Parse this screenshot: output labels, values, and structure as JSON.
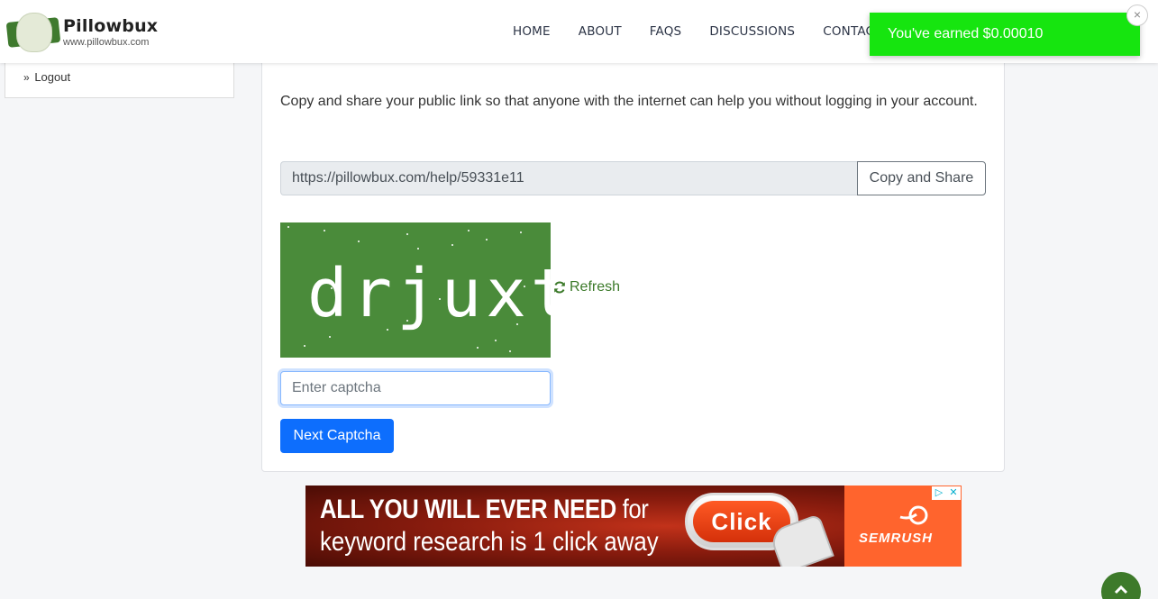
{
  "brand": {
    "name": "Pillowbux",
    "url": "www.pillowbux.com"
  },
  "nav": {
    "items": [
      "HOME",
      "ABOUT",
      "FAQS",
      "DISCUSSIONS",
      "CONTACT"
    ]
  },
  "toast": {
    "message": "You've earned $0.00010",
    "close": "×",
    "color": "#16e50f"
  },
  "sidebar": {
    "items": [
      {
        "label": "Logout",
        "icon": "double-chevron-right-icon"
      }
    ]
  },
  "main": {
    "description": "Copy and share your public link so that anyone with the internet can help you without logging in your account.",
    "public_link": "https://pillowbux.com/help/59331e11",
    "copy_button": "Copy and Share",
    "captcha": {
      "text": "drjuxt",
      "background": "#4a8b3a",
      "refresh_label": "Refresh",
      "input_placeholder": "Enter captcha",
      "input_value": "",
      "next_button": "Next Captcha"
    }
  },
  "ad": {
    "line1_bold": "ALL YOU WILL EVER NEED",
    "line1_rest": " for",
    "line2": "keyword research is 1 click away",
    "button": "Click",
    "brand": "SEMRUSH"
  },
  "colors": {
    "accent_green": "#3d7a2a",
    "primary_blue": "#0d6efd"
  }
}
